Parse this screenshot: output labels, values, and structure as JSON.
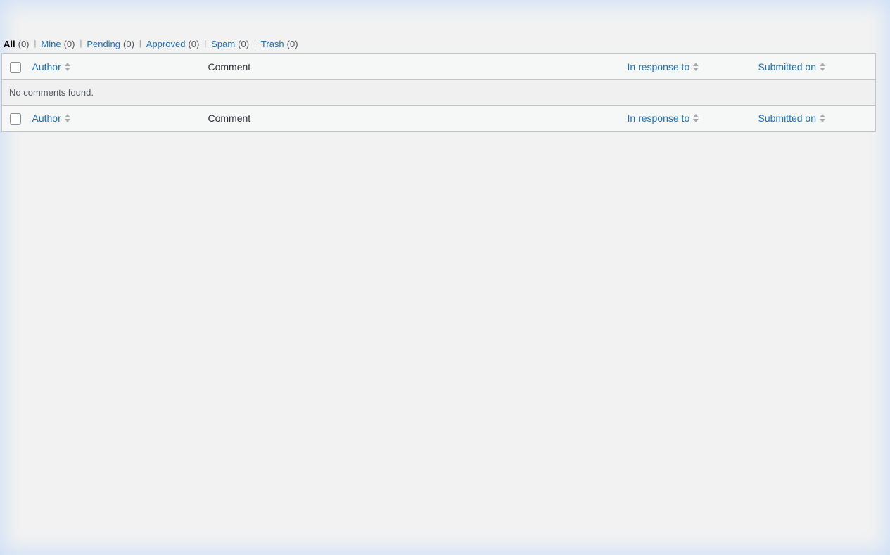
{
  "filters": [
    {
      "label": "All",
      "count": "(0)",
      "current": true
    },
    {
      "label": "Mine",
      "count": "(0)",
      "current": false
    },
    {
      "label": "Pending",
      "count": "(0)",
      "current": false
    },
    {
      "label": "Approved",
      "count": "(0)",
      "current": false
    },
    {
      "label": "Spam",
      "count": "(0)",
      "current": false
    },
    {
      "label": "Trash",
      "count": "(0)",
      "current": false
    }
  ],
  "separator": "|",
  "table": {
    "columns": {
      "author": "Author",
      "comment": "Comment",
      "response": "In response to",
      "submitted": "Submitted on"
    },
    "empty_message": "No comments found."
  },
  "colors": {
    "link": "#2271b1",
    "border": "#c3c4c7",
    "background": "#f2f2f2"
  }
}
